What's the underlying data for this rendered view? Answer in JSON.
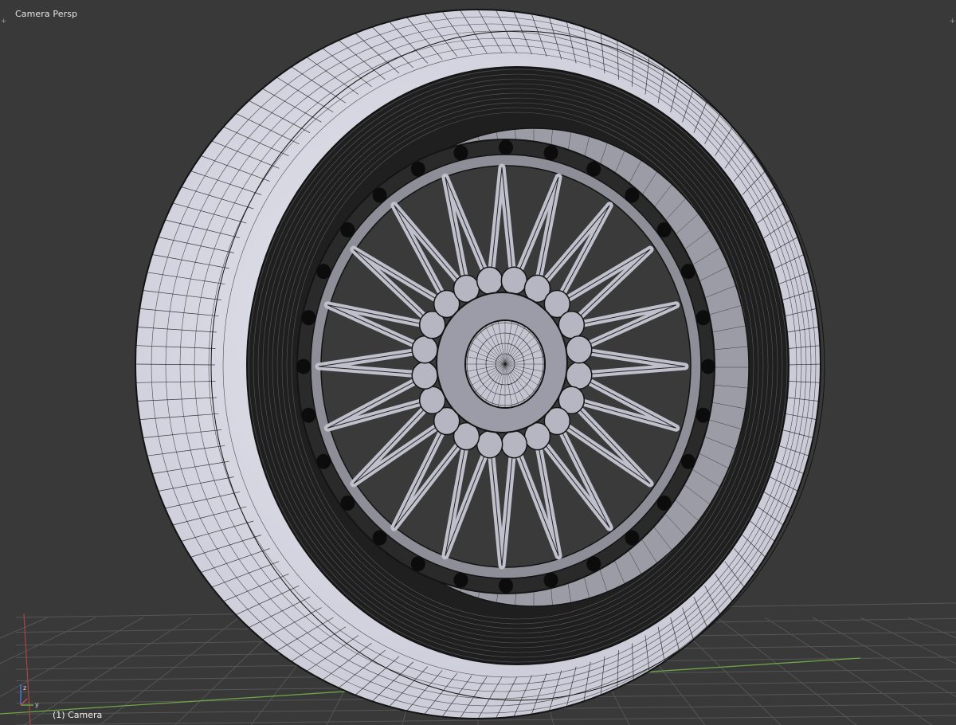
{
  "viewport": {
    "view_label": "Camera Persp",
    "object_label": "(1) Camera",
    "corner_widget_glyph": "+",
    "axis_z": "z",
    "axis_y": "y"
  },
  "colors": {
    "background": "#393939",
    "grid_line": "#555555",
    "axis_x": "#a84545",
    "axis_y": "#6fa648",
    "wire": "#141414",
    "tire_shade": "#c9cad6",
    "tire_highlight": "#e4e5ee",
    "wheel_dark": "#1f1f1f",
    "barrel": "#9c9ca6"
  },
  "icons": [
    "axis-gizmo-icon",
    "corner-resize-icon"
  ],
  "model": {
    "lug_bolt_count": 28,
    "spoke_count": 20
  }
}
